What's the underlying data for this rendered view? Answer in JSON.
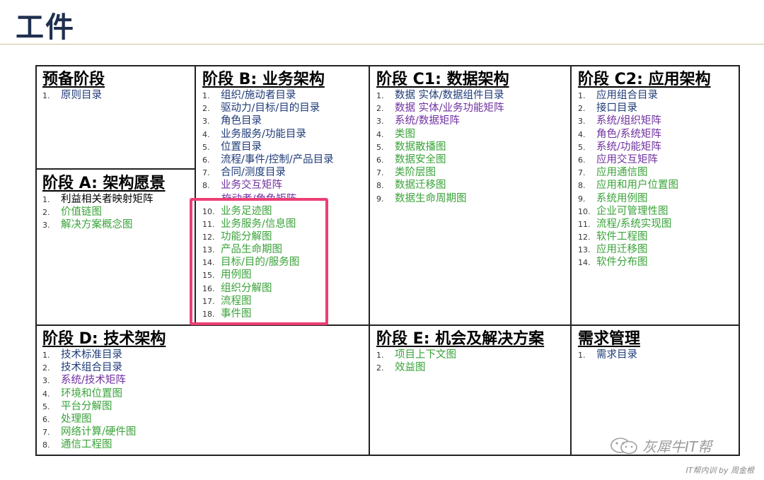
{
  "page_title": "工件",
  "cells": {
    "prelim": {
      "title": "预备阶段",
      "items": [
        {
          "n": "1.",
          "t": "原则目录",
          "c": "navy"
        }
      ]
    },
    "a": {
      "title": "阶段 A: 架构愿景",
      "items": [
        {
          "n": "1.",
          "t": "利益相关者映射矩阵",
          "c": "black"
        },
        {
          "n": "2.",
          "t": "价值链图",
          "c": "green"
        },
        {
          "n": "3.",
          "t": "解决方案概念图",
          "c": "green"
        }
      ]
    },
    "b": {
      "title": "阶段 B: 业务架构",
      "items": [
        {
          "n": "1.",
          "t": "组织/施动者目录",
          "c": "navy"
        },
        {
          "n": "2.",
          "t": "驱动力/目标/目的目录",
          "c": "navy"
        },
        {
          "n": "3.",
          "t": "角色目录",
          "c": "navy"
        },
        {
          "n": "4.",
          "t": "业务服务/功能目录",
          "c": "navy"
        },
        {
          "n": "5.",
          "t": "位置目录",
          "c": "navy"
        },
        {
          "n": "6.",
          "t": "流程/事件/控制/产品目录",
          "c": "navy"
        },
        {
          "n": "7.",
          "t": "合同/测度目录",
          "c": "navy"
        },
        {
          "n": "8.",
          "t": "业务交互矩阵",
          "c": "purple"
        },
        {
          "n": "10.",
          "t": "业务足迹图",
          "c": "green"
        },
        {
          "n": "11.",
          "t": "业务服务/信息图",
          "c": "green"
        },
        {
          "n": "12.",
          "t": "功能分解图",
          "c": "green"
        },
        {
          "n": "13.",
          "t": "产品生命期图",
          "c": "green"
        },
        {
          "n": "14.",
          "t": "目标/目的/服务图",
          "c": "green"
        },
        {
          "n": "15.",
          "t": "用例图",
          "c": "green"
        },
        {
          "n": "16.",
          "t": "组织分解图",
          "c": "green"
        },
        {
          "n": "17.",
          "t": "流程图",
          "c": "green"
        },
        {
          "n": "18.",
          "t": "事件图",
          "c": "green"
        }
      ],
      "overlap_text": "施动者/角色矩阵"
    },
    "c1": {
      "title": "阶段 C1: 数据架构",
      "items": [
        {
          "n": "1.",
          "t": "数据 实体/数据组件目录",
          "c": "navy"
        },
        {
          "n": "2.",
          "t": "数据 实体/业务功能矩阵",
          "c": "purple"
        },
        {
          "n": "3.",
          "t": "系统/数据矩阵",
          "c": "purple"
        },
        {
          "n": "4.",
          "t": "类图",
          "c": "green"
        },
        {
          "n": "5.",
          "t": "数据散播图",
          "c": "green"
        },
        {
          "n": "6.",
          "t": "数据安全图",
          "c": "green"
        },
        {
          "n": "7.",
          "t": "类阶层图",
          "c": "green"
        },
        {
          "n": "8.",
          "t": "数据迁移图",
          "c": "green"
        },
        {
          "n": "9.",
          "t": "数据生命周期图",
          "c": "green"
        }
      ]
    },
    "c2": {
      "title": "阶段 C2: 应用架构",
      "items": [
        {
          "n": "1.",
          "t": "应用组合目录",
          "c": "navy"
        },
        {
          "n": "2.",
          "t": "接口目录",
          "c": "navy"
        },
        {
          "n": "3.",
          "t": "系统/组织矩阵",
          "c": "purple"
        },
        {
          "n": "4.",
          "t": "角色/系统矩阵",
          "c": "purple"
        },
        {
          "n": "5.",
          "t": "系统/功能矩阵",
          "c": "purple"
        },
        {
          "n": "6.",
          "t": "应用交互矩阵",
          "c": "purple"
        },
        {
          "n": "7.",
          "t": "应用通信图",
          "c": "green"
        },
        {
          "n": "8.",
          "t": "应用和用户位置图",
          "c": "green"
        },
        {
          "n": "9.",
          "t": "系统用例图",
          "c": "green"
        },
        {
          "n": "10.",
          "t": "企业可管理性图",
          "c": "green"
        },
        {
          "n": "11.",
          "t": "流程/系统实现图",
          "c": "green"
        },
        {
          "n": "12.",
          "t": "软件工程图",
          "c": "green"
        },
        {
          "n": "13.",
          "t": "应用迁移图",
          "c": "green"
        },
        {
          "n": "14.",
          "t": "软件分布图",
          "c": "green"
        }
      ]
    },
    "d": {
      "title": "阶段 D: 技术架构",
      "items": [
        {
          "n": "1.",
          "t": "技术标准目录",
          "c": "navy"
        },
        {
          "n": "2.",
          "t": "技术组合目录",
          "c": "navy"
        },
        {
          "n": "3.",
          "t": "系统/技术矩阵",
          "c": "purple"
        },
        {
          "n": "4.",
          "t": "环境和位置图",
          "c": "green"
        },
        {
          "n": "5.",
          "t": "平台分解图",
          "c": "green"
        },
        {
          "n": "6.",
          "t": "处理图",
          "c": "green"
        },
        {
          "n": "7.",
          "t": "网络计算/硬件图",
          "c": "green"
        },
        {
          "n": "8.",
          "t": "通信工程图",
          "c": "green"
        }
      ]
    },
    "e": {
      "title": "阶段 E: 机会及解决方案",
      "items": [
        {
          "n": "1.",
          "t": "项目上下文图",
          "c": "green"
        },
        {
          "n": "2.",
          "t": "效益图",
          "c": "green"
        }
      ]
    },
    "req": {
      "title": "需求管理",
      "items": [
        {
          "n": "1.",
          "t": "需求目录",
          "c": "navy"
        }
      ]
    }
  },
  "watermark": "灰犀牛IT帮",
  "footer": "IT帮内训 by 周金根",
  "colors": {
    "navy": "#1f3b78",
    "purple": "#7030a0",
    "green": "#3aa33a",
    "highlight": "#ec3f74",
    "title": "#1f2f4f"
  }
}
